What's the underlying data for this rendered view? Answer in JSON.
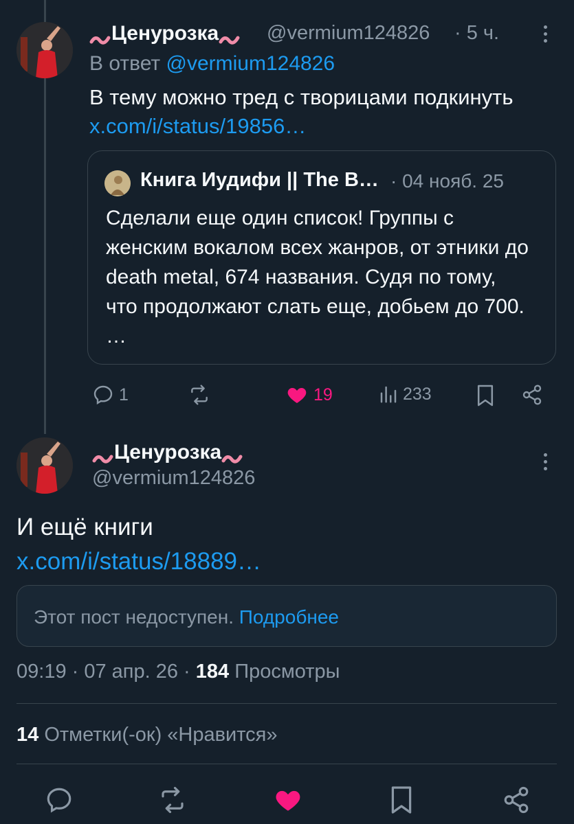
{
  "reply_tweet": {
    "display_name": "Ценурозка",
    "handle": "@vermium124826",
    "time": "· 5 ч.",
    "reply_prefix": "В ответ",
    "reply_to": "@vermium124826",
    "text": "В тему можно тред с творицами подкинуть",
    "link": "x.com/i/status/19856…",
    "quote": {
      "author": "Книга Иудифи || The B…",
      "date": "· 04 нояб. 25",
      "text": "Сделали еще один список! Группы с женским вокалом всех жанров, от этники до death metal, 674 названия. Судя по тому, что продолжают слать еще, добьем до 700. …"
    },
    "actions": {
      "replies": "1",
      "retweets": "",
      "likes": "19",
      "views": "233"
    }
  },
  "main_tweet": {
    "display_name": "Ценурозка",
    "handle": "@vermium124826",
    "text": "И ещё книги",
    "link": "x.com/i/status/18889…",
    "unavailable_text": "Этот пост недоступен.",
    "unavailable_link": "Подробнее",
    "timestamp": "09:19 · 07 апр. 26 · ",
    "views_count": "184",
    "views_label": "Просмотры",
    "likes_count": "14",
    "likes_label": "Отметки(-ок) «Нравится»"
  },
  "colors": {
    "background": "#15202b",
    "accent": "#1d9bf0",
    "like": "#f91880",
    "muted": "#8b98a5"
  }
}
